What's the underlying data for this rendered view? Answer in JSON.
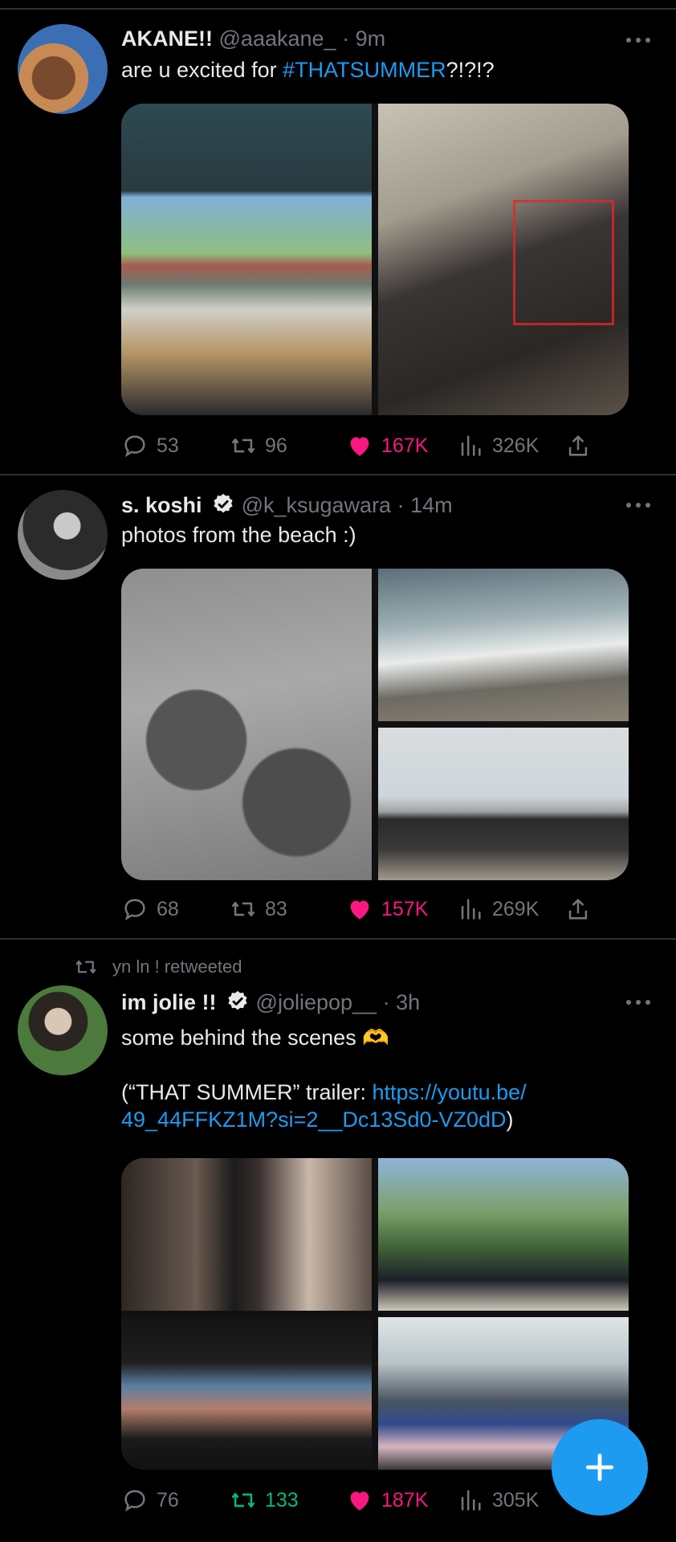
{
  "tweets": [
    {
      "name": "AKANE!!",
      "handle": "@aaakane_",
      "sep": "·",
      "time": "9m",
      "text_before": "are u excited for ",
      "hashtag": "#THATSUMMER",
      "text_after": "?!?!?",
      "replies": "53",
      "retweets": "96",
      "likes": "167K",
      "views": "326K"
    },
    {
      "name": "s. koshi",
      "handle": "@k_ksugawara",
      "sep": "·",
      "time": "14m",
      "text": "photos from the beach :)",
      "replies": "68",
      "retweets": "83",
      "likes": "157K",
      "views": "269K"
    },
    {
      "retweet_by": "yn ln ! retweeted",
      "name": "im jolie !!",
      "handle": "@joliepop__",
      "sep": "·",
      "time": "3h",
      "text": "some behind the scenes 🫶",
      "trailer_prefix": "(“THAT SUMMER” trailer: ",
      "link_line1": "https://youtu.be/",
      "link_line2": "49_44FFKZ1M?si=2__Dc13Sd0-VZ0dD",
      "trailer_suffix": ")",
      "replies": "76",
      "retweets": "133",
      "likes": "187K",
      "views": "305K"
    }
  ],
  "colors": {
    "accent": "#1d9bf0",
    "like": "#f91880",
    "retweet": "#00ba7c",
    "muted": "#71767b"
  },
  "fab_icon": "plus-icon"
}
